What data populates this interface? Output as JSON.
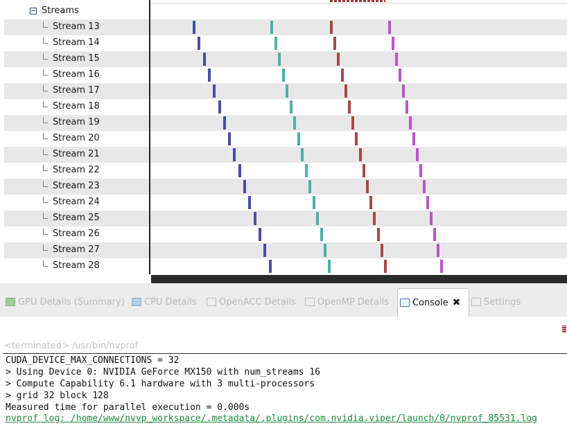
{
  "timeline": {
    "group_label": "Streams",
    "colors": {
      "k1": "#4b4ba8",
      "k2": "#4fb0a7",
      "k3": "#a84848",
      "k4": "#bb55c8"
    },
    "streams": [
      {
        "label": "Stream 13"
      },
      {
        "label": "Stream 14"
      },
      {
        "label": "Stream 15"
      },
      {
        "label": "Stream 16"
      },
      {
        "label": "Stream 17"
      },
      {
        "label": "Stream 18"
      },
      {
        "label": "Stream 19"
      },
      {
        "label": "Stream 20"
      },
      {
        "label": "Stream 21"
      },
      {
        "label": "Stream 22"
      },
      {
        "label": "Stream 23"
      },
      {
        "label": "Stream 24"
      },
      {
        "label": "Stream 25"
      },
      {
        "label": "Stream 26"
      },
      {
        "label": "Stream 27"
      },
      {
        "label": "Stream 28"
      }
    ]
  },
  "tabs": {
    "gpu_details": "GPU Details (Summary)",
    "cpu_details": "CPU Details",
    "openacc_details": "OpenACC Details",
    "openmp_details": "OpenMP Details",
    "console": "Console",
    "settings": "Settings"
  },
  "console": {
    "terminated": "<terminated> /usr/bin/nvprof",
    "lines": [
      "CUDA_DEVICE_MAX_CONNECTIONS = 32",
      "> Using Device 0: NVIDIA GeForce MX150 with num_streams 16",
      "> Compute Capability 6.1 hardware with 3 multi-processors",
      "> grid 32 block 128",
      "Measured time for parallel execution = 0.000s"
    ],
    "log_link": "nvprof log: /home/www/nvvp_workspace/.metadata/.plugins/com.nvidia.viper/launch/0/nvprof_85531.log"
  }
}
